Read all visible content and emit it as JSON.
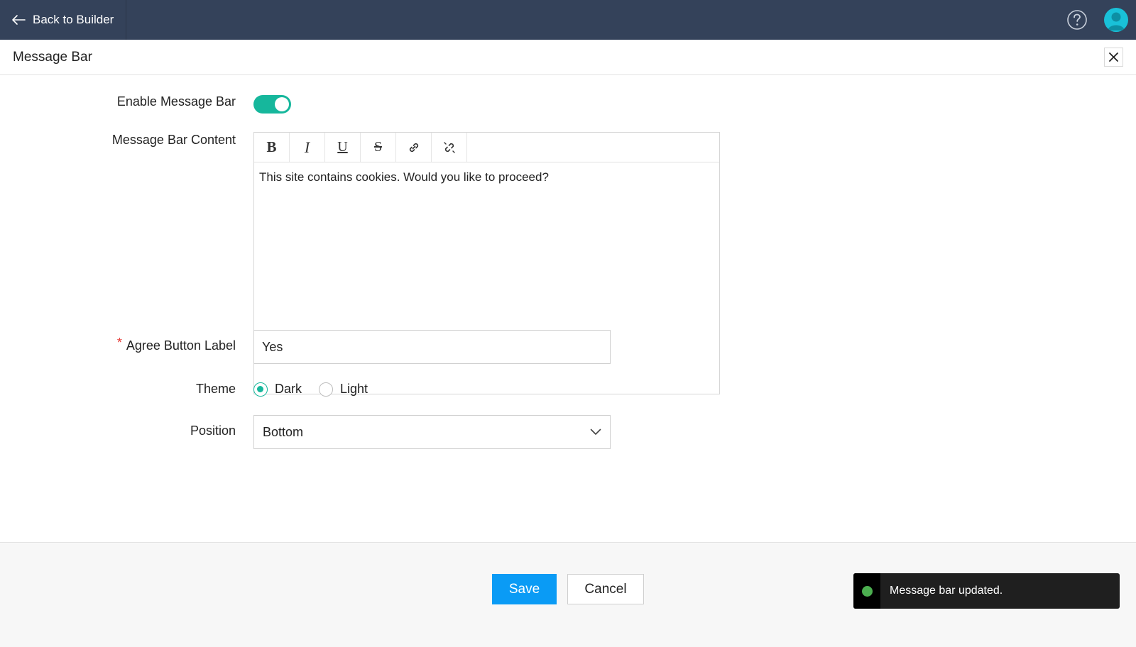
{
  "topbar": {
    "back_label": "Back to Builder"
  },
  "panel": {
    "title": "Message Bar"
  },
  "form": {
    "enable_label": "Enable Message Bar",
    "enable_on": true,
    "content_label": "Message Bar Content",
    "content_text": "This site contains cookies. Would you like to proceed?",
    "toolbar": [
      "B",
      "I",
      "U",
      "S"
    ],
    "agree_label": "Agree Button Label",
    "required_mark": "*",
    "agree_value": "Yes",
    "theme_label": "Theme",
    "theme_options": [
      "Dark",
      "Light"
    ],
    "theme_selected": "Dark",
    "position_label": "Position",
    "position_value": "Bottom"
  },
  "footer": {
    "save_label": "Save",
    "cancel_label": "Cancel"
  },
  "toast": {
    "message": "Message bar updated."
  },
  "colors": {
    "topbar": "#34425a",
    "accent": "#16b79c",
    "primary": "#0a9bf5",
    "toast_bg": "#1f1f1f",
    "toast_dot": "#4caf50"
  }
}
